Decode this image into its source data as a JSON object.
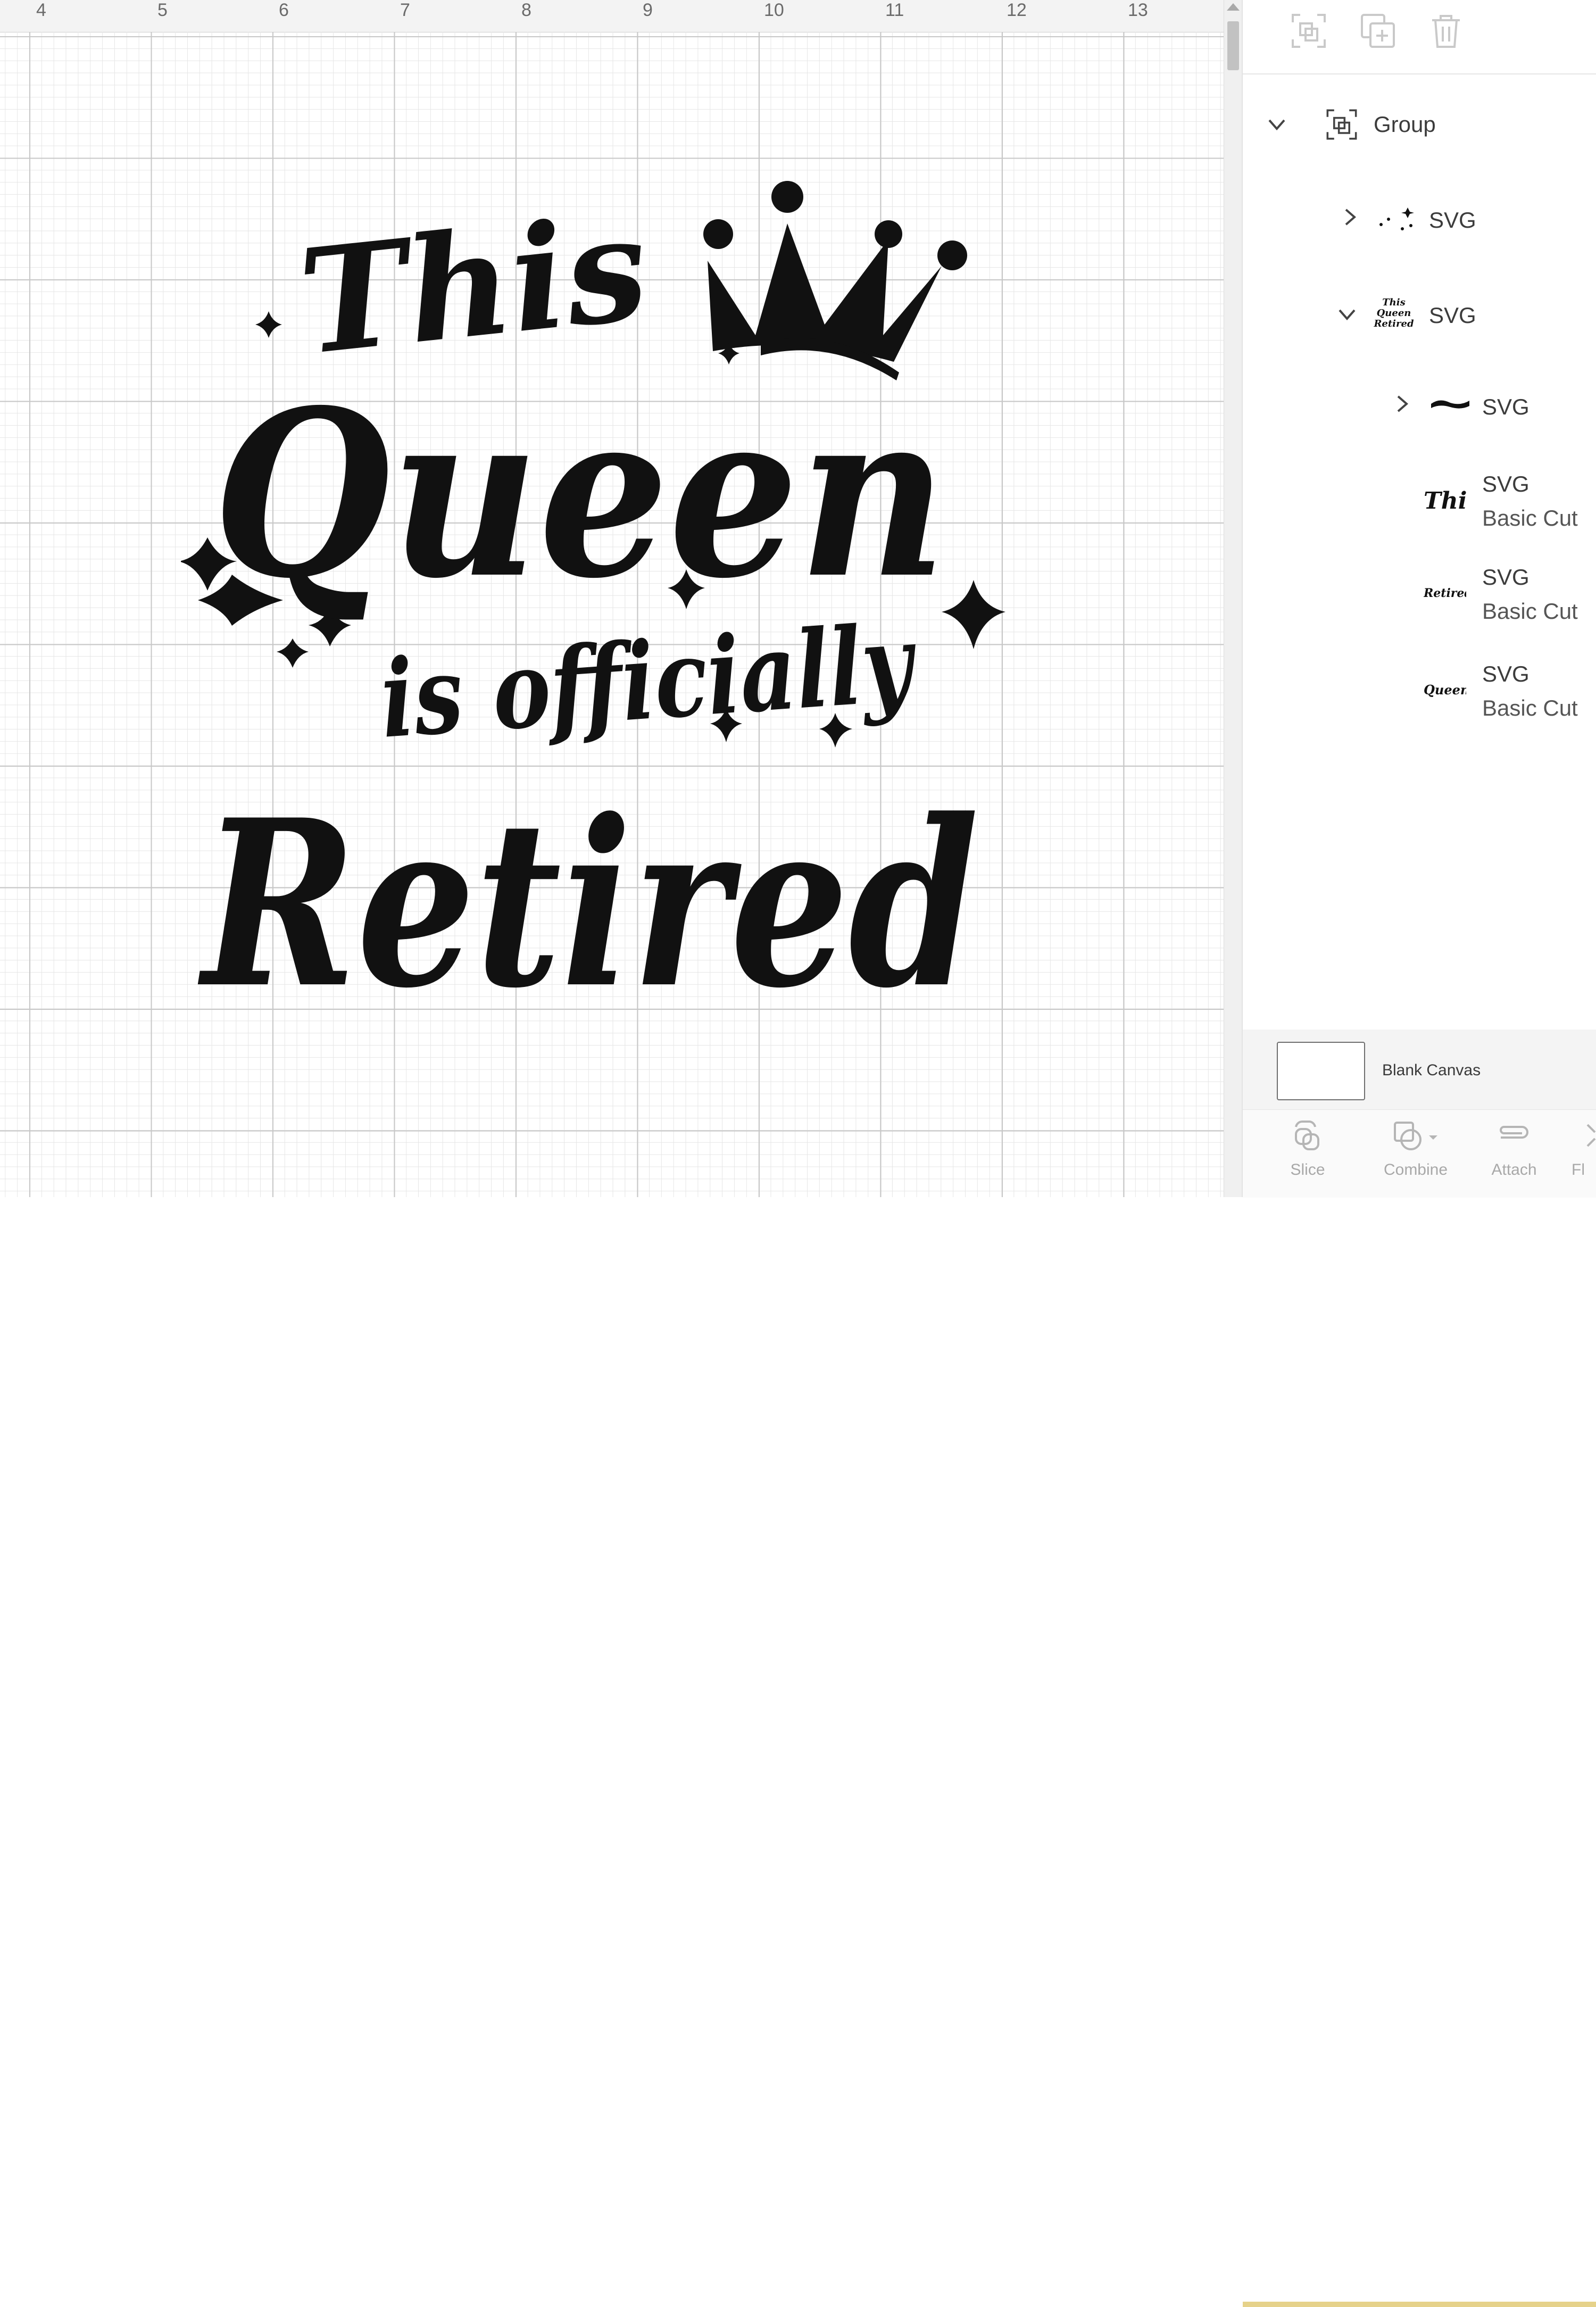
{
  "ruler": {
    "ticks": [
      "4",
      "5",
      "6",
      "7",
      "8",
      "9",
      "10",
      "11",
      "12",
      "13"
    ]
  },
  "design": {
    "line1": "This",
    "line2": "Queen",
    "line3": "is officially",
    "line4": "Retired"
  },
  "toolbar": {
    "icons": [
      "group-icon",
      "duplicate-icon",
      "delete-icon"
    ]
  },
  "layers": {
    "group": {
      "label": "Group"
    },
    "svg1": {
      "label": "SVG"
    },
    "svg2": {
      "label": "SVG"
    },
    "svg3": {
      "label": "SVG"
    },
    "svg4": {
      "label": "SVG",
      "sub": "Basic Cut",
      "thumb": "This"
    },
    "svg5": {
      "label": "SVG",
      "sub": "Basic Cut",
      "thumb": "Retired"
    },
    "svg6": {
      "label": "SVG",
      "sub": "Basic Cut",
      "thumb": "Queen"
    }
  },
  "blank_canvas": {
    "label": "Blank Canvas"
  },
  "bottom_tools": {
    "slice": "Slice",
    "combine": "Combine",
    "attach": "Attach",
    "flatten": "Fl"
  },
  "colors": {
    "ink": "#111111",
    "grid_major": "#c7c7c7",
    "grid_minor": "#e6e6e6",
    "accent": "#e6d28a"
  }
}
